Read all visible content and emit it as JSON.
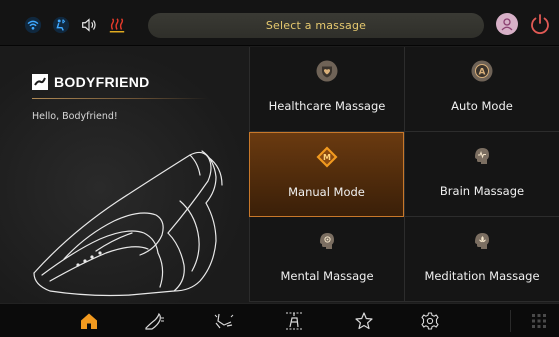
{
  "status_bar": {
    "title": "Select a massage",
    "icons": [
      "wifi-icon",
      "bluetooth-person-icon",
      "volume-icon",
      "heat-icon"
    ],
    "avatar_icon": "user-avatar-icon",
    "power_icon": "power-icon"
  },
  "sidebar": {
    "brand": "BODYFRIEND",
    "greeting": "Hello, Bodyfriend!"
  },
  "menu": {
    "items": [
      {
        "label": "Healthcare Massage",
        "icon": "heart-shield-icon",
        "active": false
      },
      {
        "label": "Auto Mode",
        "icon": "auto-a-icon",
        "active": false
      },
      {
        "label": "Manual Mode",
        "icon": "manual-m-icon",
        "active": true
      },
      {
        "label": "Brain Massage",
        "icon": "brain-head-icon",
        "active": false
      },
      {
        "label": "Mental Massage",
        "icon": "mental-head-icon",
        "active": false
      },
      {
        "label": "Meditation Massage",
        "icon": "meditation-head-icon",
        "active": false
      }
    ]
  },
  "bottom_nav": {
    "items": [
      "home-icon",
      "chair-recline-icon",
      "chair-legs-icon",
      "chair-position-icon",
      "star-icon",
      "settings-icon",
      "apps-grid-icon"
    ],
    "active": "home-icon"
  },
  "colors": {
    "accent": "#f29a1f",
    "title_text": "#e6c96f",
    "active_border": "#c8782a",
    "power": "#e25a55"
  }
}
